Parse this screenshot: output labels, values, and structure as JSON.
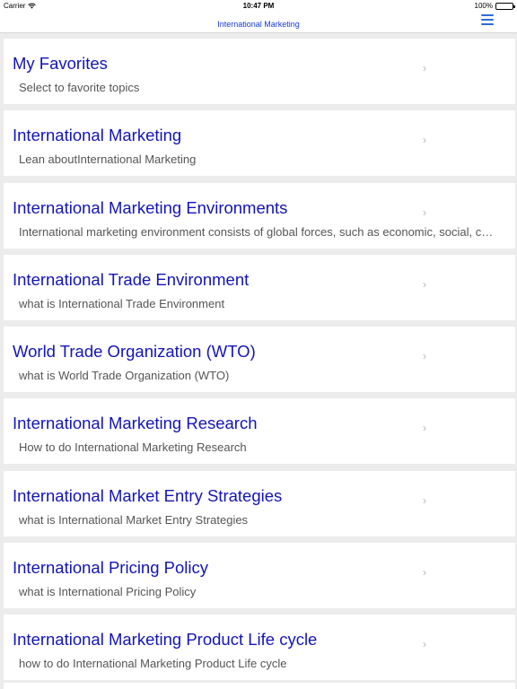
{
  "status_bar": {
    "carrier": "Carrier",
    "time": "10:47 PM",
    "battery": "100%"
  },
  "nav": {
    "title": "International Marketing",
    "menu_icon": "hamburger-menu-icon",
    "accent_color": "#2f6bd6"
  },
  "items": [
    {
      "title": "My Favorites",
      "subtitle": "Select to favorite topics"
    },
    {
      "title": "International Marketing",
      "subtitle": "Lean aboutInternational Marketing"
    },
    {
      "title": "International Marketing Environments",
      "subtitle": "International marketing environment consists of global forces, such as economic, social, cultural, legal and political"
    },
    {
      "title": "International Trade Environment",
      "subtitle": "what is International Trade Environment"
    },
    {
      "title": "World Trade Organization (WTO)",
      "subtitle": "what is World Trade Organization (WTO)"
    },
    {
      "title": "International Marketing Research",
      "subtitle": "How to do International Marketing Research"
    },
    {
      "title": "International Market Entry Strategies",
      "subtitle": "what is International Market Entry Strategies"
    },
    {
      "title": "International Pricing Policy",
      "subtitle": "what is International Pricing Policy"
    },
    {
      "title": "International Marketing Product Life cycle",
      "subtitle": "how to do International Marketing Product Life cycle"
    }
  ],
  "colors": {
    "title_text": "#1414b8",
    "subtitle_text": "#555555",
    "background": "#ececec"
  }
}
